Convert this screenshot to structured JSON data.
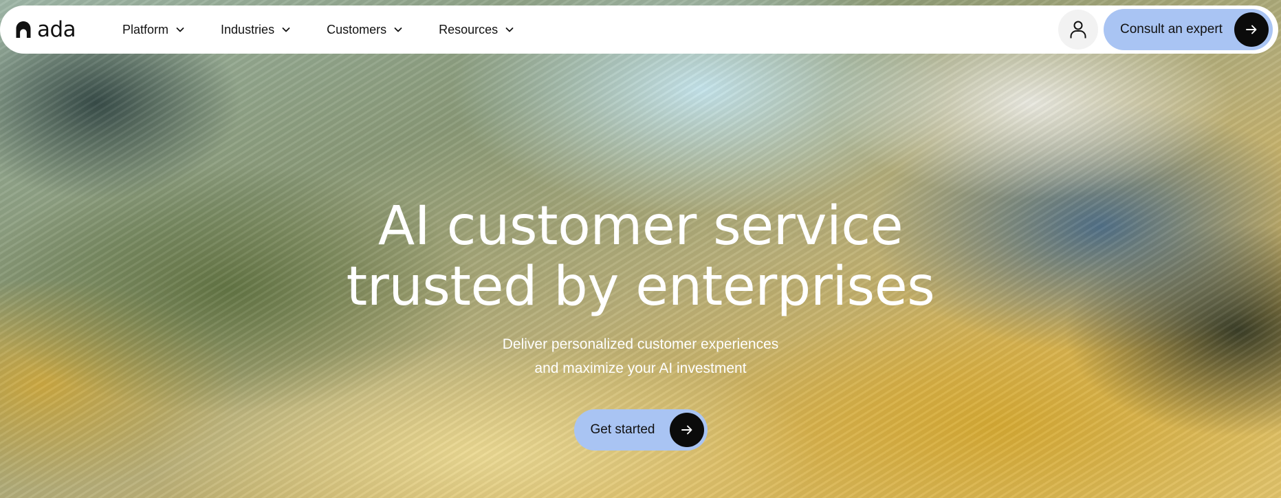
{
  "brand": {
    "name": "ada",
    "logo_icon": "ada-logo-icon"
  },
  "nav": {
    "items": [
      {
        "label": "Platform",
        "icon": "chevron-down-icon"
      },
      {
        "label": "Industries",
        "icon": "chevron-down-icon"
      },
      {
        "label": "Customers",
        "icon": "chevron-down-icon"
      },
      {
        "label": "Resources",
        "icon": "chevron-down-icon"
      }
    ],
    "account_icon": "user-icon",
    "consult_label": "Consult an expert",
    "consult_icon": "arrow-right-icon"
  },
  "hero": {
    "title_line1": "AI customer service",
    "title_line2": "trusted by enterprises",
    "subtitle_line1": "Deliver personalized customer experiences",
    "subtitle_line2": "and maximize your AI investment",
    "cta_label": "Get started",
    "cta_icon": "arrow-right-icon"
  },
  "colors": {
    "button_bg": "#a9c4f3",
    "arrow_circle_bg": "#0b0b0b",
    "nav_bg": "#ffffff",
    "hero_text": "#ffffff"
  }
}
